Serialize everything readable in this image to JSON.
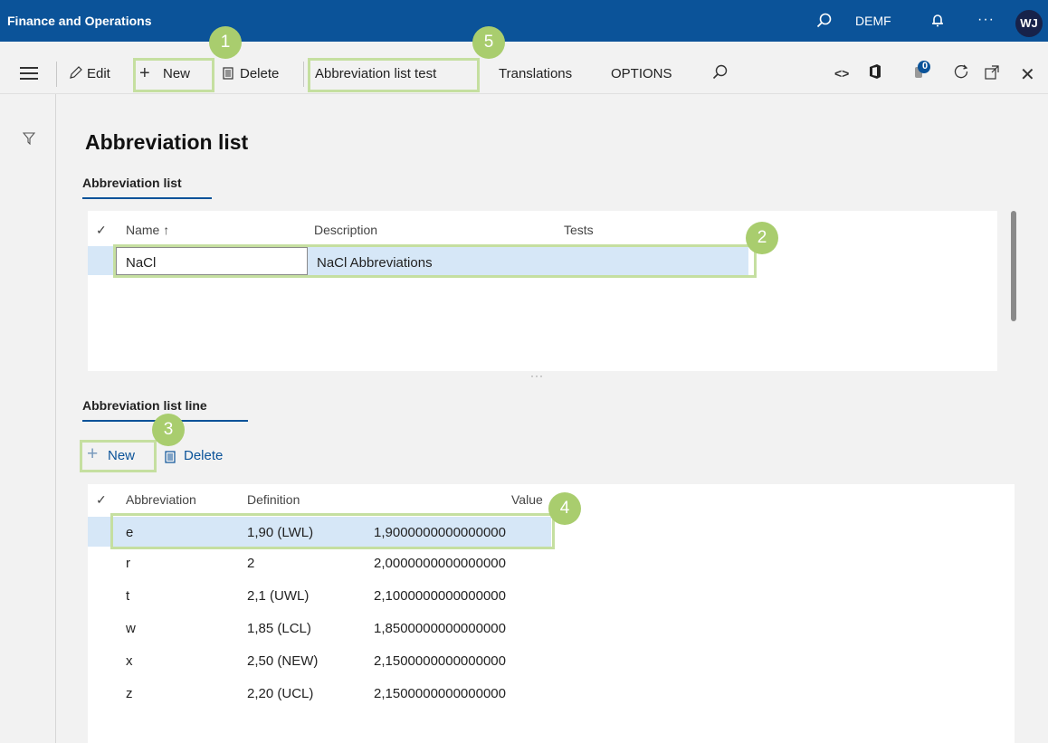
{
  "app": {
    "title": "Finance and Operations",
    "company": "DEMF",
    "avatar": "WJ"
  },
  "top_icons": {
    "search": "search-icon",
    "notifications": "bell-icon",
    "more": "more-icon"
  },
  "toolbar": {
    "edit": "Edit",
    "new": "New",
    "delete": "Delete",
    "test": "Abbreviation list test",
    "translations": "Translations",
    "options": "OPTIONS",
    "notification_count": "0"
  },
  "page": {
    "title": "Abbreviation list"
  },
  "list_section": {
    "title": "Abbreviation list",
    "columns": [
      "Name ↑",
      "Description",
      "Tests"
    ],
    "rows": [
      {
        "name": "NaCl",
        "description": "NaCl Abbreviations",
        "tests": ""
      }
    ]
  },
  "lines_section": {
    "title": "Abbreviation list line",
    "new": "New",
    "delete": "Delete",
    "columns": [
      "Abbreviation",
      "Definition",
      "Value"
    ],
    "rows": [
      {
        "abbreviation": "e",
        "definition": "1,90 (LWL)",
        "value": "1,9000000000000000"
      },
      {
        "abbreviation": "r",
        "definition": "2",
        "value": "2,0000000000000000"
      },
      {
        "abbreviation": "t",
        "definition": "2,1 (UWL)",
        "value": "2,1000000000000000"
      },
      {
        "abbreviation": "w",
        "definition": "1,85 (LCL)",
        "value": "1,8500000000000000"
      },
      {
        "abbreviation": "x",
        "definition": "2,50 (NEW)",
        "value": "2,1500000000000000"
      },
      {
        "abbreviation": "z",
        "definition": "2,20 (UCL)",
        "value": "2,1500000000000000"
      }
    ]
  },
  "callouts": [
    "1",
    "2",
    "3",
    "4",
    "5"
  ],
  "colors": {
    "brand": "#0b5399",
    "selection": "#d6e7f7",
    "callout": "#a9cd6e"
  }
}
